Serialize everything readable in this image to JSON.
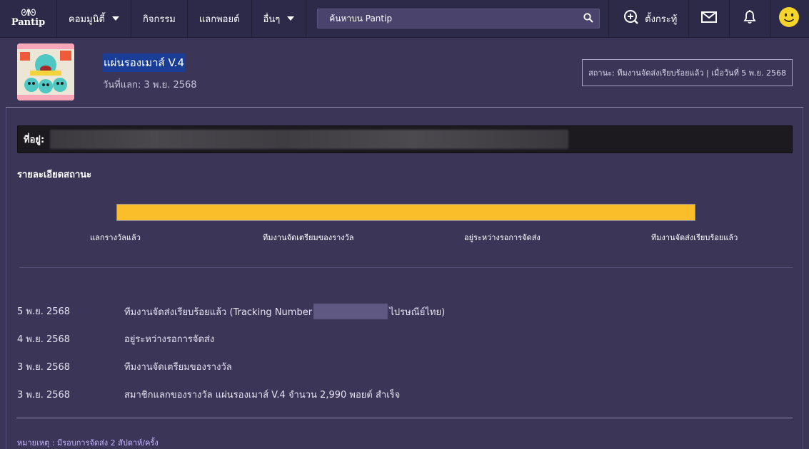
{
  "nav": {
    "logo_text": "Pantip",
    "items": [
      {
        "label": "คอมมูนิตี้",
        "has_caret": true
      },
      {
        "label": "กิจกรรม",
        "has_caret": false
      },
      {
        "label": "แลกพอยต์",
        "has_caret": false
      },
      {
        "label": "อื่นๆ",
        "has_caret": true
      }
    ],
    "search_placeholder": "ค้นหาบน Pantip",
    "post_label": "ตั้งกระทู้",
    "icons": [
      "search-icon",
      "add-post-icon",
      "mail-icon",
      "bell-icon",
      "smiley-avatar-icon"
    ]
  },
  "reward": {
    "title": "แผ่นรองเมาส์ V.4",
    "date_line": "วันที่แลก: 3 พ.ย. 2568",
    "status_line": "สถานะ: ทีมงานจัดส่งเรียบร้อยแล้ว | เมื่อวันที่ 5 พ.ย. 2568"
  },
  "address": {
    "label": "ที่อยู่:"
  },
  "status_section": {
    "title": "รายละเอียดสถานะ",
    "progress_fraction": 1.0,
    "steps": [
      "แลกรางวัลแล้ว",
      "ทีมงานจัดเตรียมของรางวัล",
      "อยู่ระหว่างรอการจัดส่ง",
      "ทีมงานจัดส่งเรียบร้อยแล้ว"
    ]
  },
  "history": [
    {
      "date": "5 พ.ย. 2568",
      "text_before": "ทีมงานจัดส่งเรียบร้อยแล้ว (Tracking Number",
      "text_after": "ไปรษณีย์ไทย)"
    },
    {
      "date": "4 พ.ย. 2568",
      "text": "อยู่ระหว่างรอการจัดส่ง"
    },
    {
      "date": "3 พ.ย. 2568",
      "text": "ทีมงานจัดเตรียมของรางวัล"
    },
    {
      "date": "3 พ.ย. 2568",
      "text": "สมาชิกแลกของรางวัล แผ่นรองเมาส์ V.4 จำนวน 2,990 พอยต์ สำเร็จ"
    }
  ],
  "note": "หมายเหตุ : มีรอบการจัดส่ง 2 สัปดาห์/ครั้ง",
  "colors": {
    "nav_bg": "#2d2a49",
    "page_bg": "#3b3558",
    "progress_fill": "#fbbe2b",
    "note_text": "#c7b4ff",
    "title_highlight": "#1a3e96"
  }
}
